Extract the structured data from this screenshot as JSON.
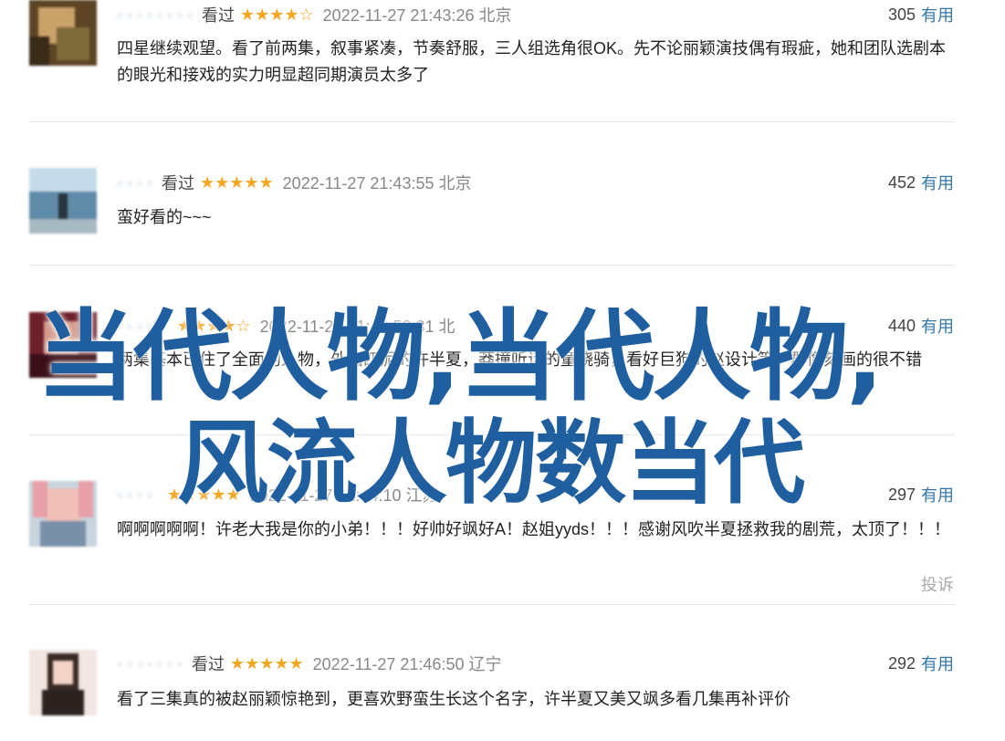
{
  "comments": [
    {
      "username": "· · · · · · · ·",
      "watched": "看过",
      "stars": "★★★★☆",
      "time": "2022-11-27 21:43:26 北京",
      "votes": "305",
      "useful": "有用",
      "content": "四星继续观望。看了前两集，叙事紧凑，节奏舒服，三人组选角很OK。先不论丽颖演技偶有瑕疵，她和团队选剧本的眼光和接戏的实力明显超同期演员太多了"
    },
    {
      "username": "· · · ·",
      "watched": "看过",
      "stars": "★★★★★",
      "time": "2022-11-27 21:43:55 北京",
      "votes": "452",
      "useful": "有用",
      "content": "蛮好看的~~~"
    },
    {
      "username": "· · · · ·",
      "watched": "",
      "stars": "★★★★☆",
      "time": "2022-11-27 21:43:58:31 北",
      "votes": "440",
      "useful": "有用",
      "content": "两集基本已住了全面的人物，外面四泥的许半夏，莽撞听话的童骁骑，看好巨狗的赵设计等，群像刻画的很不错"
    },
    {
      "username": "· · · ·",
      "watched": "",
      "stars": "★★★★★",
      "time": "2022-11-27 21:44:10 江苏",
      "votes": "297",
      "useful": "有用",
      "content": "啊啊啊啊啊！许老大我是你的小弟！！！好帅好飒好A！赵姐yyds！！！感谢风吹半夏拯救我的剧荒，太顶了！！！",
      "report": "投诉"
    },
    {
      "username": "· · · · · · ·",
      "watched": "看过",
      "stars": "★★★★★",
      "time": "2022-11-27 21:46:50 辽宁",
      "votes": "292",
      "useful": "有用",
      "content": "看了三集真的被赵丽颖惊艳到，更喜欢野蛮生长这个名字，许半夏又美又飒多看几集再补评价"
    }
  ],
  "overlay": {
    "line1": "当代人物,当代人物,",
    "line2": "风流人物数当代"
  },
  "colors": {
    "link": "#3377aa",
    "star": "#f5a623",
    "overlay": "#1f5fa0",
    "divider": "#e6e6e6"
  }
}
